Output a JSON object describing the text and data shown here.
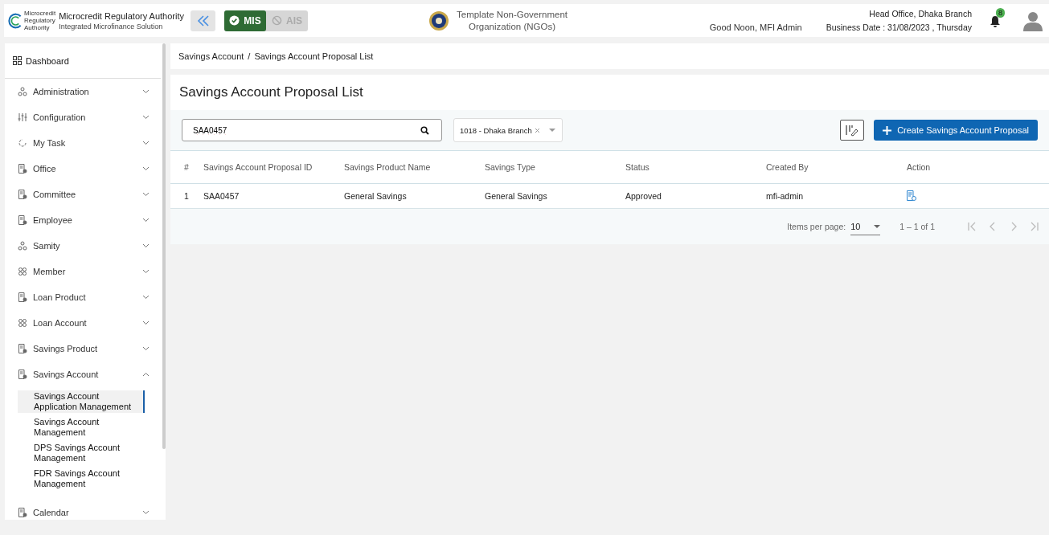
{
  "header": {
    "logo_text": [
      "Microcredit",
      "Regulatory",
      "Authority"
    ],
    "title": "Microcredit Regulatory Authority",
    "subtitle": "Integrated Microfinance Solution",
    "modes": [
      {
        "label": "MIS",
        "selected": true
      },
      {
        "label": "AIS",
        "selected": false
      }
    ],
    "org_name": "Template Non-Government Organization (NGOs)",
    "greeting": "Good Noon, MFI Admin",
    "office": "Head Office, Dhaka Branch",
    "business_date": "Business Date : 31/08/2023 , Thursday",
    "notification_count": "8"
  },
  "sidebar": {
    "dashboard": "Dashboard",
    "items": [
      {
        "label": "Administration",
        "expanded": false
      },
      {
        "label": "Configuration",
        "expanded": false
      },
      {
        "label": "My Task",
        "expanded": false
      },
      {
        "label": "Office",
        "expanded": false
      },
      {
        "label": "Committee",
        "expanded": false
      },
      {
        "label": "Employee",
        "expanded": false
      },
      {
        "label": "Samity",
        "expanded": false
      },
      {
        "label": "Member",
        "expanded": false
      },
      {
        "label": "Loan Product",
        "expanded": false
      },
      {
        "label": "Loan Account",
        "expanded": false
      },
      {
        "label": "Savings Product",
        "expanded": false
      },
      {
        "label": "Savings Account",
        "expanded": true,
        "children": [
          {
            "label": "Savings Account Application Management",
            "selected": true
          },
          {
            "label": "Savings Account Management",
            "selected": false
          },
          {
            "label": "DPS Savings Account Management",
            "selected": false
          },
          {
            "label": "FDR Savings Account Management",
            "selected": false
          }
        ]
      },
      {
        "label": "Calendar",
        "expanded": false
      }
    ]
  },
  "breadcrumb": [
    "Savings Account",
    "Savings Account Proposal List"
  ],
  "breadcrumb_separator": "/",
  "page_title": "Savings Account Proposal List",
  "search": {
    "value": "SAA0457"
  },
  "branch_select": {
    "value": "1018 - Dhaka Branch"
  },
  "create_button": "Create Savings Account Proposal",
  "table": {
    "columns": [
      "#",
      "Savings Account Proposal ID",
      "Savings Product Name",
      "Savings Type",
      "Status",
      "Created By",
      "Action"
    ],
    "rows": [
      {
        "cells": [
          "1",
          "SAA0457",
          "General Savings",
          "General Savings",
          "Approved",
          "mfi-admin"
        ]
      }
    ]
  },
  "pagination": {
    "label": "Items per page:",
    "page_size": "10",
    "range": "1 – 1 of 1"
  }
}
